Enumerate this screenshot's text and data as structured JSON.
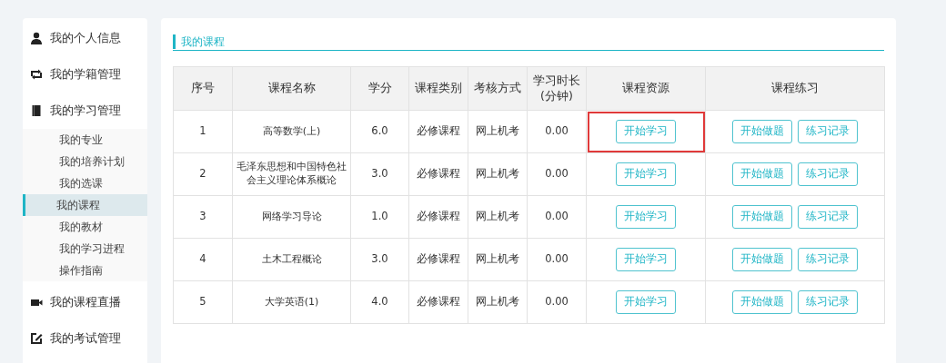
{
  "sidebar": {
    "items": [
      {
        "label": "我的个人信息"
      },
      {
        "label": "我的学籍管理"
      },
      {
        "label": "我的学习管理",
        "children": [
          {
            "label": "我的专业",
            "selected": false
          },
          {
            "label": "我的培养计划",
            "selected": false
          },
          {
            "label": "我的选课",
            "selected": false
          },
          {
            "label": "我的课程",
            "selected": true
          },
          {
            "label": "我的教材",
            "selected": false
          },
          {
            "label": "我的学习进程",
            "selected": false
          },
          {
            "label": "操作指南",
            "selected": false
          }
        ]
      },
      {
        "label": "我的课程直播"
      },
      {
        "label": "我的考试管理"
      }
    ]
  },
  "main": {
    "title": "我的课程",
    "table": {
      "columns": [
        "序号",
        "课程名称",
        "学分",
        "课程类别",
        "考核方式",
        "学习时长\n(分钟)",
        "课程资源",
        "课程练习"
      ],
      "rows": [
        {
          "cells": [
            "1",
            "高等数学(上)",
            "6.0",
            "必修课程",
            "网上机考",
            "0.00"
          ],
          "resource_button": "开始学习",
          "practice_buttons": [
            "开始做题",
            "练习记录"
          ],
          "highlighted": true
        },
        {
          "cells": [
            "2",
            "毛泽东思想和中国特色社会主义理论体系概论",
            "3.0",
            "必修课程",
            "网上机考",
            "0.00"
          ],
          "resource_button": "开始学习",
          "practice_buttons": [
            "开始做题",
            "练习记录"
          ],
          "highlighted": false
        },
        {
          "cells": [
            "3",
            "网络学习导论",
            "1.0",
            "必修课程",
            "网上机考",
            "0.00"
          ],
          "resource_button": "开始学习",
          "practice_buttons": [
            "开始做题",
            "练习记录"
          ],
          "highlighted": false
        },
        {
          "cells": [
            "4",
            "土木工程概论",
            "3.0",
            "必修课程",
            "网上机考",
            "0.00"
          ],
          "resource_button": "开始学习",
          "practice_buttons": [
            "开始做题",
            "练习记录"
          ],
          "highlighted": false
        },
        {
          "cells": [
            "5",
            "大学英语(1)",
            "4.0",
            "必修课程",
            "网上机考",
            "0.00"
          ],
          "resource_button": "开始学习",
          "practice_buttons": [
            "开始做题",
            "练习记录"
          ],
          "highlighted": false
        }
      ]
    }
  }
}
